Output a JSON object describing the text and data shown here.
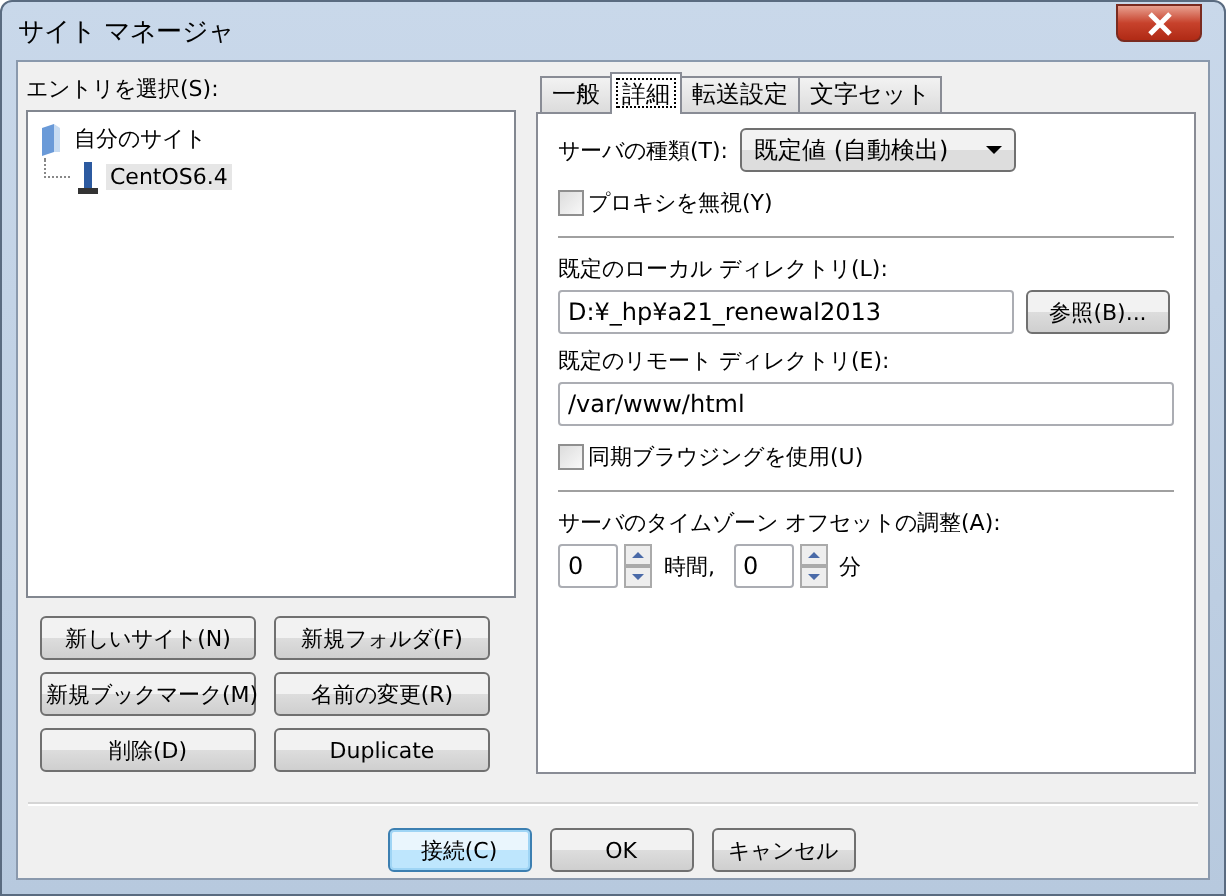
{
  "window": {
    "title": "サイト マネージャ"
  },
  "entries_label": "エントリを選択(S):",
  "tree": [
    {
      "label": "自分のサイト",
      "selected": false,
      "children": [
        {
          "label": "CentOS6.4",
          "selected": true
        }
      ]
    }
  ],
  "site_buttons": [
    "新しいサイト(N)",
    "新規フォルダ(F)",
    "新規ブックマーク(M)",
    "名前の変更(R)",
    "削除(D)",
    "Duplicate"
  ],
  "tabs": [
    {
      "label": "一般",
      "selected": false
    },
    {
      "label": "詳細",
      "selected": true
    },
    {
      "label": "転送設定",
      "selected": false
    },
    {
      "label": "文字セット",
      "selected": false
    }
  ],
  "advanced": {
    "server_type": {
      "label": "サーバの種類(T):",
      "value": "既定値 (自動検出)"
    },
    "bypass_proxy": {
      "label": "プロキシを無視(Y)",
      "checked": false
    },
    "local_dir": {
      "label": "既定のローカル ディレクトリ(L):",
      "value": "D:¥_hp¥a21_renewal2013",
      "browse": "参照(B)..."
    },
    "remote_dir": {
      "label": "既定のリモート ディレクトリ(E):",
      "value": "/var/www/html"
    },
    "sync_browsing": {
      "label": "同期ブラウジングを使用(U)",
      "checked": false
    },
    "timezone": {
      "label": "サーバのタイムゾーン オフセットの調整(A):",
      "hours": "0",
      "hours_unit": "時間,",
      "minutes": "0",
      "minutes_unit": "分"
    }
  },
  "buttons": [
    {
      "label": "接続(C)",
      "default": true
    },
    {
      "label": "OK",
      "default": false
    },
    {
      "label": "キャンセル",
      "default": false
    }
  ]
}
